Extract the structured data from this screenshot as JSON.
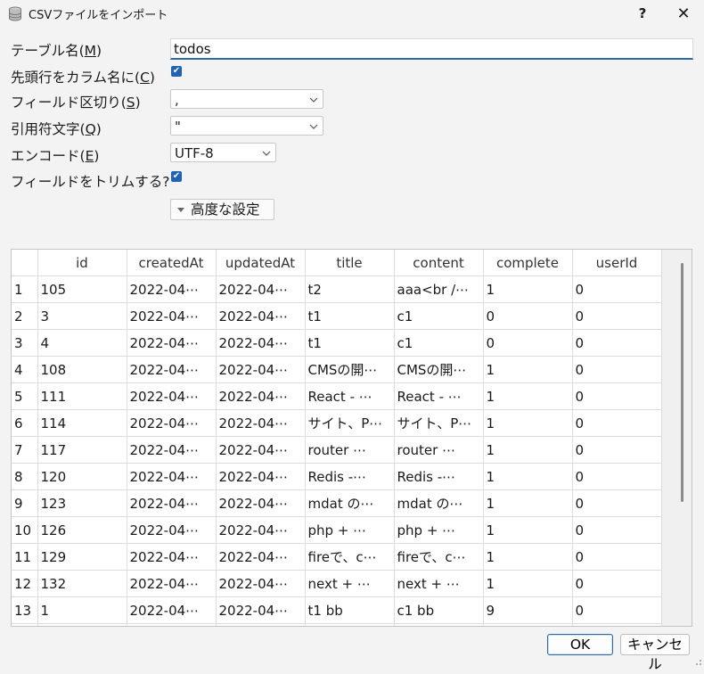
{
  "window": {
    "title": "CSVファイルをインポート",
    "help": "?",
    "close": "✕"
  },
  "form": {
    "table_name_label": "テーブル名(",
    "table_name_key": "M",
    "table_name_value": "todos",
    "header_label": "先頭行をカラム名に(",
    "header_key": "C",
    "header_checked": true,
    "sep_label": "フィールド区切り(",
    "sep_key": "S",
    "sep_value": ",",
    "quote_label": "引用符文字(",
    "quote_key": "Q",
    "quote_value": "\"",
    "encoding_label": "エンコード(",
    "encoding_key": "E",
    "encoding_value": "UTF-8",
    "trim_label": "フィールドをトリムする?",
    "trim_checked": true,
    "advanced_label": "高度な設定",
    "close_paren": ")"
  },
  "table": {
    "columns": [
      "",
      "id",
      "createdAt",
      "updatedAt",
      "title",
      "content",
      "complete",
      "userId"
    ],
    "rows": [
      [
        "1",
        "105",
        "2022-04⋯",
        "2022-04⋯",
        "t2",
        "aaa<br /⋯",
        "1",
        "0"
      ],
      [
        "2",
        "3",
        "2022-04⋯",
        "2022-04⋯",
        "t1",
        "c1",
        "0",
        "0"
      ],
      [
        "3",
        "4",
        "2022-04⋯",
        "2022-04⋯",
        "t1",
        "c1",
        "0",
        "0"
      ],
      [
        "4",
        "108",
        "2022-04⋯",
        "2022-04⋯",
        "CMSの開⋯",
        "CMSの開⋯",
        "1",
        "0"
      ],
      [
        "5",
        "111",
        "2022-04⋯",
        "2022-04⋯",
        "React - ⋯",
        "React - ⋯",
        "1",
        "0"
      ],
      [
        "6",
        "114",
        "2022-04⋯",
        "2022-04⋯",
        "サイト、P⋯",
        "サイト、P⋯",
        "1",
        "0"
      ],
      [
        "7",
        "117",
        "2022-04⋯",
        "2022-04⋯",
        "router ⋯",
        "router ⋯",
        "1",
        "0"
      ],
      [
        "8",
        "120",
        "2022-04⋯",
        "2022-04⋯",
        "Redis -⋯",
        "Redis -⋯",
        "1",
        "0"
      ],
      [
        "9",
        "123",
        "2022-04⋯",
        "2022-04⋯",
        "mdat の⋯",
        "mdat の⋯",
        "1",
        "0"
      ],
      [
        "10",
        "126",
        "2022-04⋯",
        "2022-04⋯",
        "php + ⋯",
        "php + ⋯",
        "1",
        "0"
      ],
      [
        "11",
        "129",
        "2022-04⋯",
        "2022-04⋯",
        "fireで、c⋯",
        "fireで、c⋯",
        "1",
        "0"
      ],
      [
        "12",
        "132",
        "2022-04⋯",
        "2022-04⋯",
        "next + ⋯",
        "next + ⋯",
        "1",
        "0"
      ],
      [
        "13",
        "1",
        "2022-04⋯",
        "2022-04⋯",
        "t1 bb",
        "c1 bb",
        "9",
        "0"
      ]
    ]
  },
  "buttons": {
    "ok": "OK",
    "cancel": "キャンセル"
  },
  "colors": {
    "accent": "#1e63b8",
    "focus_border": "#2d6aa6",
    "window_bg": "#f3f3f3"
  }
}
